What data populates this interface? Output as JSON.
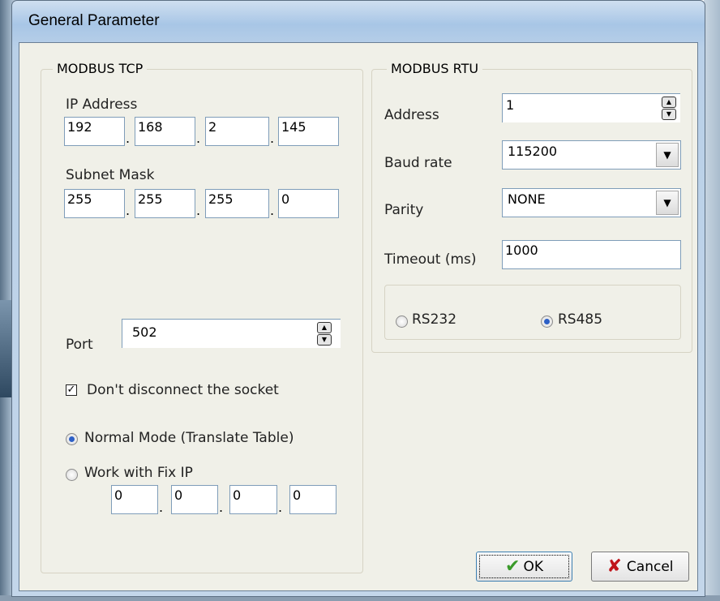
{
  "window": {
    "title": "General Parameter"
  },
  "tcp": {
    "group_label": "MODBUS TCP",
    "ip_label": "IP Address",
    "ip": [
      "192",
      "168",
      "2",
      "145"
    ],
    "mask_label": "Subnet Mask",
    "mask": [
      "255",
      "255",
      "255",
      "0"
    ],
    "port_label": "Port",
    "port": "502",
    "dont_disconnect_label": "Don't disconnect the socket",
    "dont_disconnect_checked": true,
    "normal_mode_label": "Normal Mode (Translate Table)",
    "fix_ip_label": "Work with Fix IP",
    "mode_selected": "Normal Mode (Translate Table)",
    "fix_ip": [
      "0",
      "0",
      "0",
      "0"
    ]
  },
  "rtu": {
    "group_label": "MODBUS RTU",
    "address_label": "Address",
    "address": "1",
    "baud_label": "Baud rate",
    "baud": "115200",
    "parity_label": "Parity",
    "parity": "NONE",
    "timeout_label": "Timeout (ms)",
    "timeout": "1000",
    "rs232_label": "RS232",
    "rs485_label": "RS485",
    "serial_selected": "RS485"
  },
  "buttons": {
    "ok": "OK",
    "cancel": "Cancel"
  },
  "icons": {
    "ok": "check-icon",
    "cancel": "x-icon",
    "spin": "spinner-icon",
    "dropdown": "dropdown-arrow-icon"
  }
}
